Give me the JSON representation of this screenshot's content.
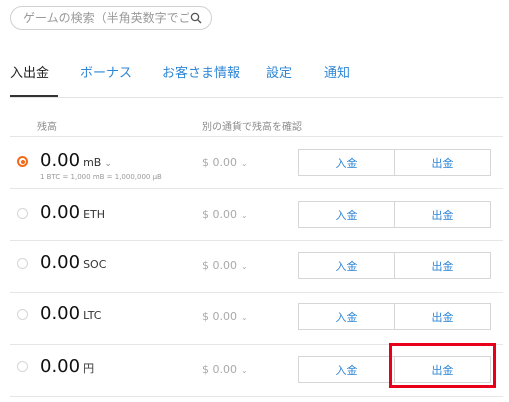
{
  "search": {
    "placeholder": "ゲームの検索（半角英数字でご検"
  },
  "tabs": [
    {
      "label": "入出金"
    },
    {
      "label": "ボーナス"
    },
    {
      "label": "お客さま情報"
    },
    {
      "label": "設定"
    },
    {
      "label": "通知"
    }
  ],
  "columns": {
    "balance": "残高",
    "other_currency": "別の通貨で残高を確認"
  },
  "rows": [
    {
      "amount": "0.00",
      "currency": "mB",
      "sub": "1 BTC = 1,000 mB = 1,000,000 µB",
      "usd": "$ 0.00",
      "deposit": "入金",
      "withdraw": "出金",
      "selected": true
    },
    {
      "amount": "0.00",
      "currency": "ETH",
      "usd": "$ 0.00",
      "deposit": "入金",
      "withdraw": "出金",
      "selected": false
    },
    {
      "amount": "0.00",
      "currency": "SOC",
      "usd": "$ 0.00",
      "deposit": "入金",
      "withdraw": "出金",
      "selected": false
    },
    {
      "amount": "0.00",
      "currency": "LTC",
      "usd": "$ 0.00",
      "deposit": "入金",
      "withdraw": "出金",
      "selected": false
    },
    {
      "amount": "0.00",
      "currency": "円",
      "usd": "$ 0.00",
      "deposit": "入金",
      "withdraw": "出金",
      "selected": false
    }
  ],
  "colors": {
    "accent": "#2f86d6",
    "radio_selected": "#f26a1b",
    "highlight": "#e8001a"
  }
}
